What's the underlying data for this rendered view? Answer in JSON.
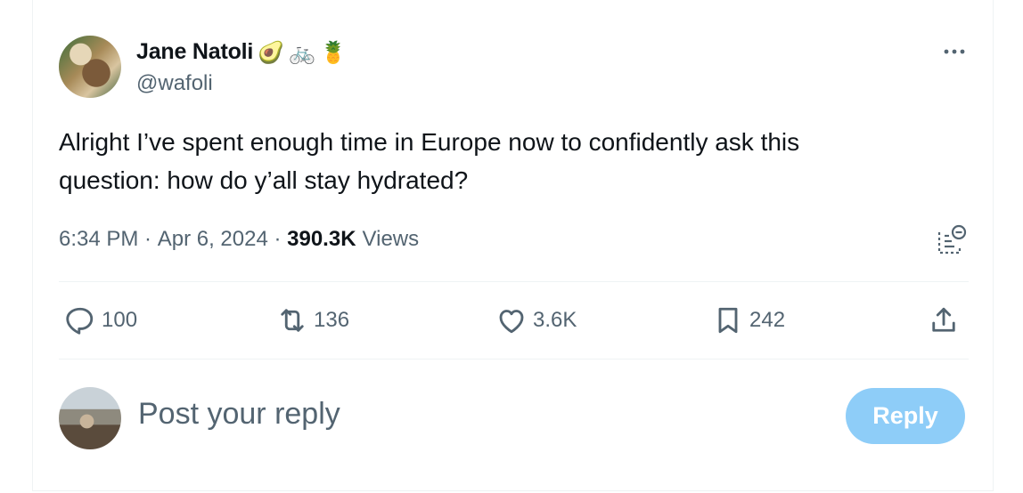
{
  "author": {
    "name": "Jane Natoli",
    "emojis": [
      "🥑",
      "🚲",
      "🍍"
    ],
    "handle": "@wafoli"
  },
  "tweet": {
    "text_line1": "Alright I’ve spent enough time in Europe now to confidently ask this",
    "text_line2": "question: how do y’all stay hydrated?",
    "time": "6:34 PM",
    "date": "Apr 6, 2024",
    "views_count": "390.3K",
    "views_label": "Views",
    "separator": " · "
  },
  "actions": {
    "replies": "100",
    "reposts": "136",
    "likes": "3.6K",
    "bookmarks": "242"
  },
  "reply_box": {
    "placeholder": "Post your reply",
    "button": "Reply"
  },
  "icons": [
    "more-icon",
    "analytics-icon",
    "reply-icon",
    "repost-icon",
    "like-icon",
    "bookmark-icon",
    "share-icon"
  ],
  "colors": {
    "text": "#0f1419",
    "secondary": "#536471",
    "reply_button": "#8ecdf8",
    "divider": "#eff3f4"
  }
}
